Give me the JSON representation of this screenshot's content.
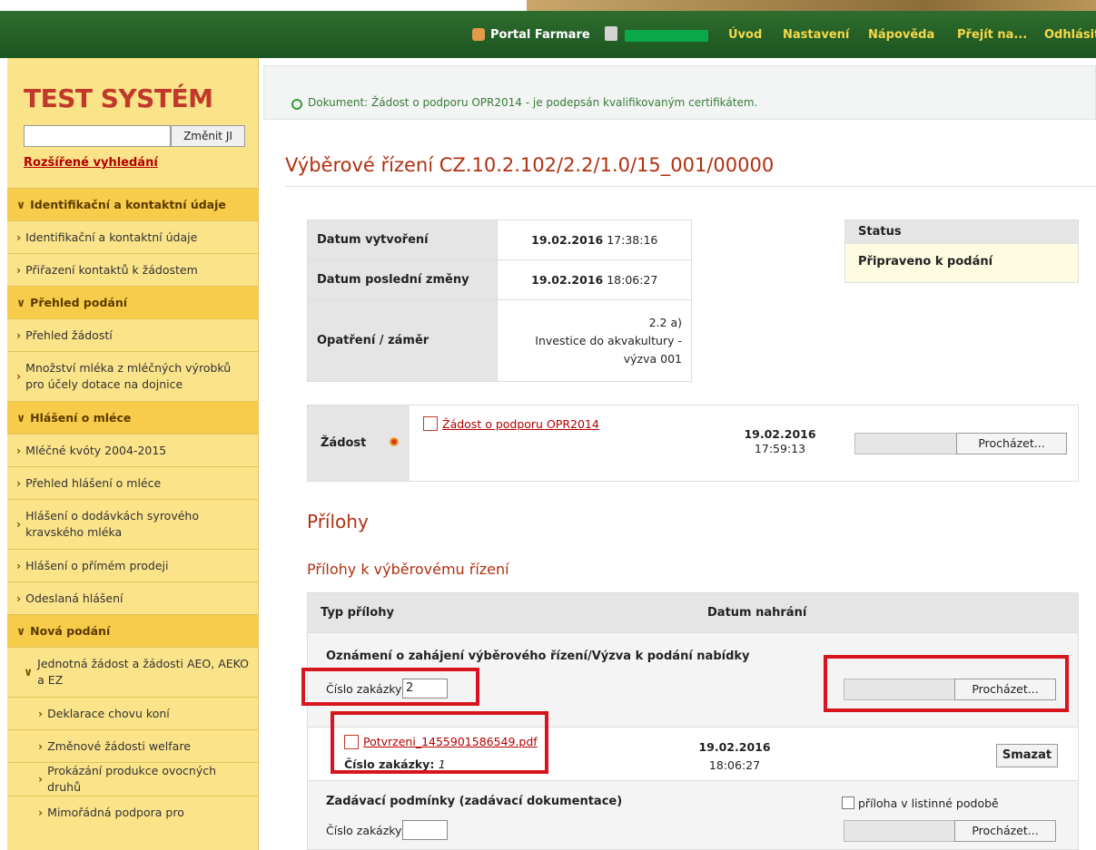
{
  "topbar": {
    "portal": "Portal Farmare",
    "nav": [
      "Úvod",
      "Nastavení",
      "Nápověda",
      "Přejít na...",
      "Odhlásit"
    ]
  },
  "sidebar": {
    "title": "TEST SYSTÉM",
    "search_button": "Změnit JI",
    "advanced_search": "Rozšířené vyhledání",
    "menu": [
      {
        "type": "cat",
        "label": "Identifikační a kontaktní údaje"
      },
      {
        "type": "item",
        "label": "Identifikační a kontaktní údaje"
      },
      {
        "type": "item",
        "label": "Přiřazení kontaktů k žádostem"
      },
      {
        "type": "cat",
        "label": "Přehled podání"
      },
      {
        "type": "item",
        "label": "Přehled žádostí"
      },
      {
        "type": "item",
        "label": "Množství mléka z mléčných výrobků pro účely dotace na dojnice"
      },
      {
        "type": "cat",
        "label": "Hlášení o mléce"
      },
      {
        "type": "item",
        "label": "Mléčné kvóty 2004-2015"
      },
      {
        "type": "item",
        "label": "Přehled hlášení o mléce"
      },
      {
        "type": "item",
        "label": "Hlášení o dodávkách syrového kravského mléka"
      },
      {
        "type": "item",
        "label": "Hlášení o přímém prodeji"
      },
      {
        "type": "item",
        "label": "Odeslaná hlášení"
      },
      {
        "type": "cat",
        "label": "Nová podání"
      },
      {
        "type": "item",
        "label": "Jednotná žádost a žádosti AEO, AEKO a EZ"
      },
      {
        "type": "sub",
        "label": "Deklarace chovu koní"
      },
      {
        "type": "sub",
        "label": "Změnové žádosti welfare"
      },
      {
        "type": "sub",
        "label": "Prokázání produkce ovocných druhů"
      },
      {
        "type": "sub",
        "label": "Mimořádná podpora pro"
      }
    ]
  },
  "notice": "Dokument: Žádost o podporu OPR2014 - je podepsán kvalifikovaným certifikátem.",
  "page_title": "Výběrové řízení CZ.10.2.102/2.2/1.0/15_001/00000",
  "info": {
    "created_label": "Datum vytvoření",
    "created_date": "19.02.2016",
    "created_time": "17:38:16",
    "changed_label": "Datum poslední změny",
    "changed_date": "19.02.2016",
    "changed_time": "18:06:27",
    "measure_label": "Opatření / záměr",
    "measure_line1": "2.2 a)",
    "measure_line2": "Investice do akvakultury -",
    "measure_line3": "výzva 001"
  },
  "status": {
    "header": "Status",
    "value": "Připraveno k podání"
  },
  "application": {
    "label": "Žádost",
    "link": "Žádost o podporu OPR2014",
    "date": "19.02.2016",
    "time": "17:59:13",
    "browse": "Procházet..."
  },
  "attachments": {
    "title": "Přílohy",
    "subtitle": "Přílohy k výběrovému řízení",
    "col_type": "Typ přílohy",
    "col_date": "Datum nahrání",
    "sec1": "Oznámení o zahájení výběrového řízení/Výzva k podání nabídky",
    "num_label": "Číslo zakázky:",
    "sec1_num": "2",
    "browse": "Procházet...",
    "file_link": "Potvrzeni_1455901586549.pdf",
    "file_num_label": "Číslo zakázky:",
    "file_num": "1",
    "file_date": "19.02.2016",
    "file_time": "18:06:27",
    "delete": "Smazat",
    "sec2": "Zadávací podmínky (zadávací dokumentace)",
    "paper_label": "příloha v listinné podobě"
  }
}
